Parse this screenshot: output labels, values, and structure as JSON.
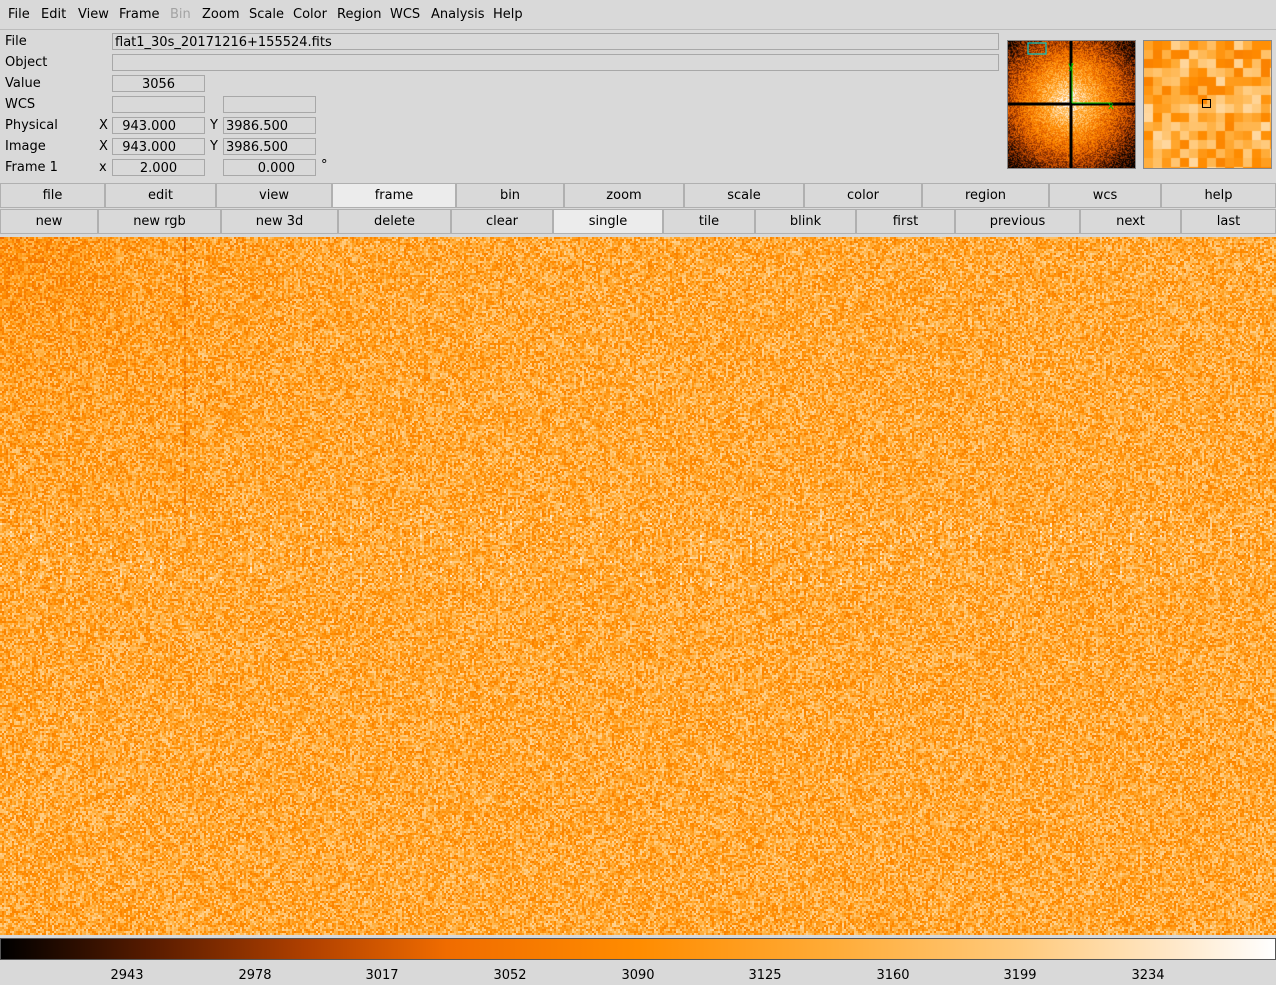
{
  "menubar": {
    "items": [
      {
        "label": "File",
        "enabled": true
      },
      {
        "label": "Edit",
        "enabled": true
      },
      {
        "label": "View",
        "enabled": true
      },
      {
        "label": "Frame",
        "enabled": true
      },
      {
        "label": "Bin",
        "enabled": false
      },
      {
        "label": "Zoom",
        "enabled": true
      },
      {
        "label": "Scale",
        "enabled": true
      },
      {
        "label": "Color",
        "enabled": true
      },
      {
        "label": "Region",
        "enabled": true
      },
      {
        "label": "WCS",
        "enabled": true
      },
      {
        "label": "Analysis",
        "enabled": true
      },
      {
        "label": "Help",
        "enabled": true
      }
    ]
  },
  "info": {
    "file_label": "File",
    "file_value": "flat1_30s_20171216+155524.fits",
    "object_label": "Object",
    "object_value": "",
    "value_label": "Value",
    "value_value": "3056",
    "wcs_label": "WCS",
    "wcs_x": "",
    "wcs_y": "",
    "physical_label": "Physical",
    "physical_x_axis": "X",
    "physical_x": "943.000",
    "physical_y_axis": "Y",
    "physical_y": "3986.500",
    "image_label": "Image",
    "image_x_axis": "X",
    "image_x": "943.000",
    "image_y_axis": "Y",
    "image_y": "3986.500",
    "frame_label": "Frame 1",
    "frame_axis": "x",
    "frame_zoom": "2.000",
    "frame_angle": "0.000",
    "frame_angle_unit": "°"
  },
  "buttonbar1": {
    "buttons": [
      "file",
      "edit",
      "view",
      "frame",
      "bin",
      "zoom",
      "scale",
      "color",
      "region",
      "wcs",
      "help"
    ],
    "active": "frame"
  },
  "buttonbar2": {
    "buttons": [
      "new",
      "new rgb",
      "new 3d",
      "delete",
      "clear",
      "single",
      "tile",
      "blink",
      "first",
      "previous",
      "next",
      "last"
    ],
    "active": "single"
  },
  "colorbar": {
    "colormap": "heat",
    "ticks": [
      "2943",
      "2978",
      "3017",
      "3052",
      "3090",
      "3125",
      "3160",
      "3199",
      "3234"
    ]
  },
  "colors": {
    "background": "#d9d9d9",
    "image_base": "#f7c271",
    "panner_box": "#00c8c8",
    "compass": "#00c000"
  }
}
